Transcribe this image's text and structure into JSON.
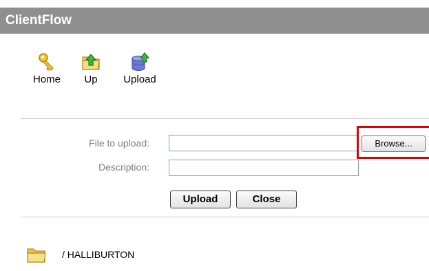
{
  "app": {
    "title": "ClientFlow"
  },
  "toolbar": {
    "items": [
      {
        "label": "Home",
        "icon": "key-icon"
      },
      {
        "label": "Up",
        "icon": "folder-up-icon"
      },
      {
        "label": "Upload",
        "icon": "database-upload-icon"
      }
    ]
  },
  "form": {
    "file_label": "File to upload:",
    "file_value": "",
    "browse_label": "Browse...",
    "description_label": "Description:",
    "description_value": "",
    "upload_label": "Upload",
    "close_label": "Close"
  },
  "folder": {
    "path": "/ HALLIBURTON",
    "icon": "folder-icon"
  },
  "colors": {
    "titlebar": "#8f8f8f",
    "highlight": "#e00000",
    "label_text": "#808080"
  }
}
